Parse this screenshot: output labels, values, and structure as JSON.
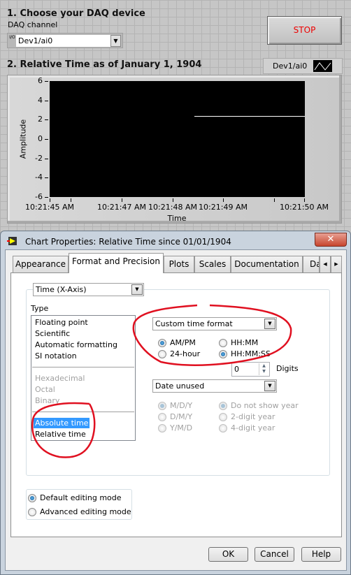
{
  "front_panel": {
    "section1_title": "1. Choose your DAQ device",
    "daq_channel_label": "DAQ channel",
    "daq_channel_value": "Dev1/ai0",
    "io_glyph": "I/O",
    "stop_label": "STOP",
    "section2_title": "2. Relative Time as of January 1, 1904",
    "legend_label": "Dev1/ai0",
    "stop_color": "#e00000"
  },
  "chart_data": {
    "type": "line",
    "title": "",
    "xlabel": "Time",
    "ylabel": "Amplitude",
    "ylim": [
      -6,
      6
    ],
    "y_ticks": [
      "6",
      "4",
      "2",
      "0",
      "-2",
      "-4",
      "-6"
    ],
    "x_tick_labels": [
      "10:21:45 AM",
      "10:21:47 AM",
      "10:21:48 AM",
      "10:21:49 AM",
      "10:21:50 AM"
    ],
    "series": [
      {
        "name": "Dev1/ai0",
        "x_start": "10:21:48.4 AM",
        "x_end": "10:21:50 AM",
        "value": 2.4,
        "color": "#ffffff"
      }
    ],
    "background": "#000000",
    "grid": false
  },
  "dialog": {
    "title": "Chart Properties: Relative Time since 01/01/1904",
    "close_label": "✕",
    "tabs": [
      "Appearance",
      "Format and Precision",
      "Plots",
      "Scales",
      "Documentation",
      "Da"
    ],
    "active_tab": "Format and Precision",
    "axis_select": "Time (X-Axis)",
    "type_label": "Type",
    "type_items": [
      "Floating point",
      "Scientific",
      "Automatic formatting",
      "SI notation"
    ],
    "type_items_disabled": [
      "Hexadecimal",
      "Octal",
      "Binary"
    ],
    "time_items": [
      "Absolute time",
      "Relative time"
    ],
    "selected_type": "Absolute time",
    "time_format_select": "Custom time format",
    "time_radios": [
      {
        "label": "AM/PM",
        "checked": true
      },
      {
        "label": "HH:MM",
        "checked": false
      },
      {
        "label": "24-hour",
        "checked": false
      },
      {
        "label": "HH:MM:SS",
        "checked": true
      }
    ],
    "digits_value": "0",
    "digits_label": "Digits",
    "date_select": "Date unused",
    "date_radios": [
      {
        "label": "M/D/Y",
        "checked": true
      },
      {
        "label": "Do not show year",
        "checked": true
      },
      {
        "label": "D/M/Y",
        "checked": false
      },
      {
        "label": "2-digit year",
        "checked": false
      },
      {
        "label": "Y/M/D",
        "checked": false
      },
      {
        "label": "4-digit year",
        "checked": false
      }
    ],
    "editing_modes": [
      {
        "label": "Default editing mode",
        "checked": true
      },
      {
        "label": "Advanced editing mode",
        "checked": false
      }
    ],
    "ok_label": "OK",
    "cancel_label": "Cancel",
    "help_label": "Help",
    "annotation_color": "#e01020"
  }
}
